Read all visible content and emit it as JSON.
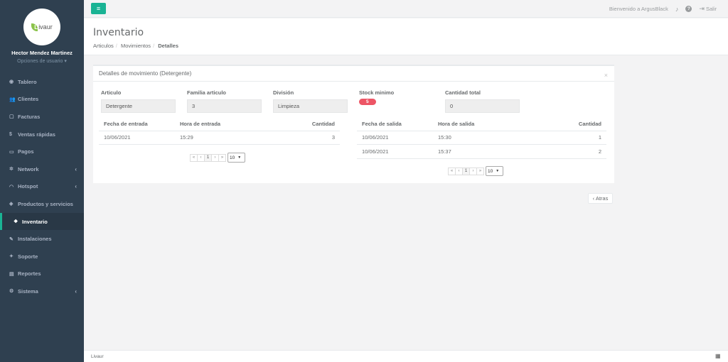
{
  "sidebar": {
    "logo_text": "ivaur",
    "logo_letter": "L",
    "user_name": "Hector Mendez Martinez",
    "user_options": "Opciones de usuario",
    "items": [
      {
        "label": "Tablero",
        "icon": "tachometer-icon",
        "glyph": "◉",
        "chevron": ""
      },
      {
        "label": "Clientes",
        "icon": "users-icon",
        "glyph": "👥",
        "chevron": ""
      },
      {
        "label": "Facturas",
        "icon": "file-icon",
        "glyph": "▢",
        "chevron": ""
      },
      {
        "label": "Ventas rápidas",
        "icon": "dollar-icon",
        "glyph": "$",
        "chevron": ""
      },
      {
        "label": "Pagos",
        "icon": "money-icon",
        "glyph": "▭",
        "chevron": ""
      },
      {
        "label": "Network",
        "icon": "network-icon",
        "glyph": "✲",
        "chevron": "‹"
      },
      {
        "label": "Hotspot",
        "icon": "wifi-icon",
        "glyph": "◠",
        "chevron": "‹"
      },
      {
        "label": "Productos y servicios",
        "icon": "tags-icon",
        "glyph": "◈",
        "chevron": ""
      },
      {
        "label": "Inventario",
        "icon": "cubes-icon",
        "glyph": "❖",
        "chevron": ""
      },
      {
        "label": "Instalaciones",
        "icon": "wrench-icon",
        "glyph": "✎",
        "chevron": ""
      },
      {
        "label": "Soporte",
        "icon": "support-icon",
        "glyph": "✦",
        "chevron": ""
      },
      {
        "label": "Reportes",
        "icon": "book-icon",
        "glyph": "▤",
        "chevron": ""
      },
      {
        "label": "Sistema",
        "icon": "cogs-icon",
        "glyph": "⚙",
        "chevron": "‹"
      }
    ]
  },
  "topbar": {
    "welcome": "Bienvenido a ArgusBlack",
    "logout": "Salir",
    "menu_glyph": "≡",
    "bell_glyph": "🔔",
    "help_glyph": "?",
    "logout_glyph": "⇥"
  },
  "heading": {
    "title": "Inventario",
    "crumbs": [
      "Articulos",
      "Movimientos",
      "Detalles"
    ]
  },
  "panel": {
    "title": "Detalles de movimiento (Detergente)",
    "close": "×",
    "fields": [
      {
        "label": "Articulo",
        "value": "Detergente"
      },
      {
        "label": "Familia articulo",
        "value": "3"
      },
      {
        "label": "División",
        "value": "Limpieza"
      },
      {
        "label": "Stock minimo",
        "value": "5"
      },
      {
        "label": "Cantidad total",
        "value": "0"
      }
    ],
    "entradas": {
      "headers": [
        "Fecha de entrada",
        "Hora de entrada",
        "Cantidad"
      ],
      "rows": [
        [
          "10/06/2021",
          "15:29",
          "3"
        ]
      ]
    },
    "salidas": {
      "headers": [
        "Fecha de salida",
        "Hora de salida",
        "Cantidad"
      ],
      "rows": [
        [
          "10/06/2021",
          "15:30",
          "1"
        ],
        [
          "10/06/2021",
          "15:37",
          "2"
        ]
      ]
    },
    "pager": {
      "first": "«",
      "prev": "‹",
      "page": "1",
      "next": "›",
      "last": "»",
      "page_size": "10"
    }
  },
  "back_button": "‹ Atras",
  "footer": {
    "brand": "Livaur"
  },
  "colors": {
    "accent": "#1ab394",
    "sidebar": "#2f4050",
    "danger": "#ed5565"
  }
}
